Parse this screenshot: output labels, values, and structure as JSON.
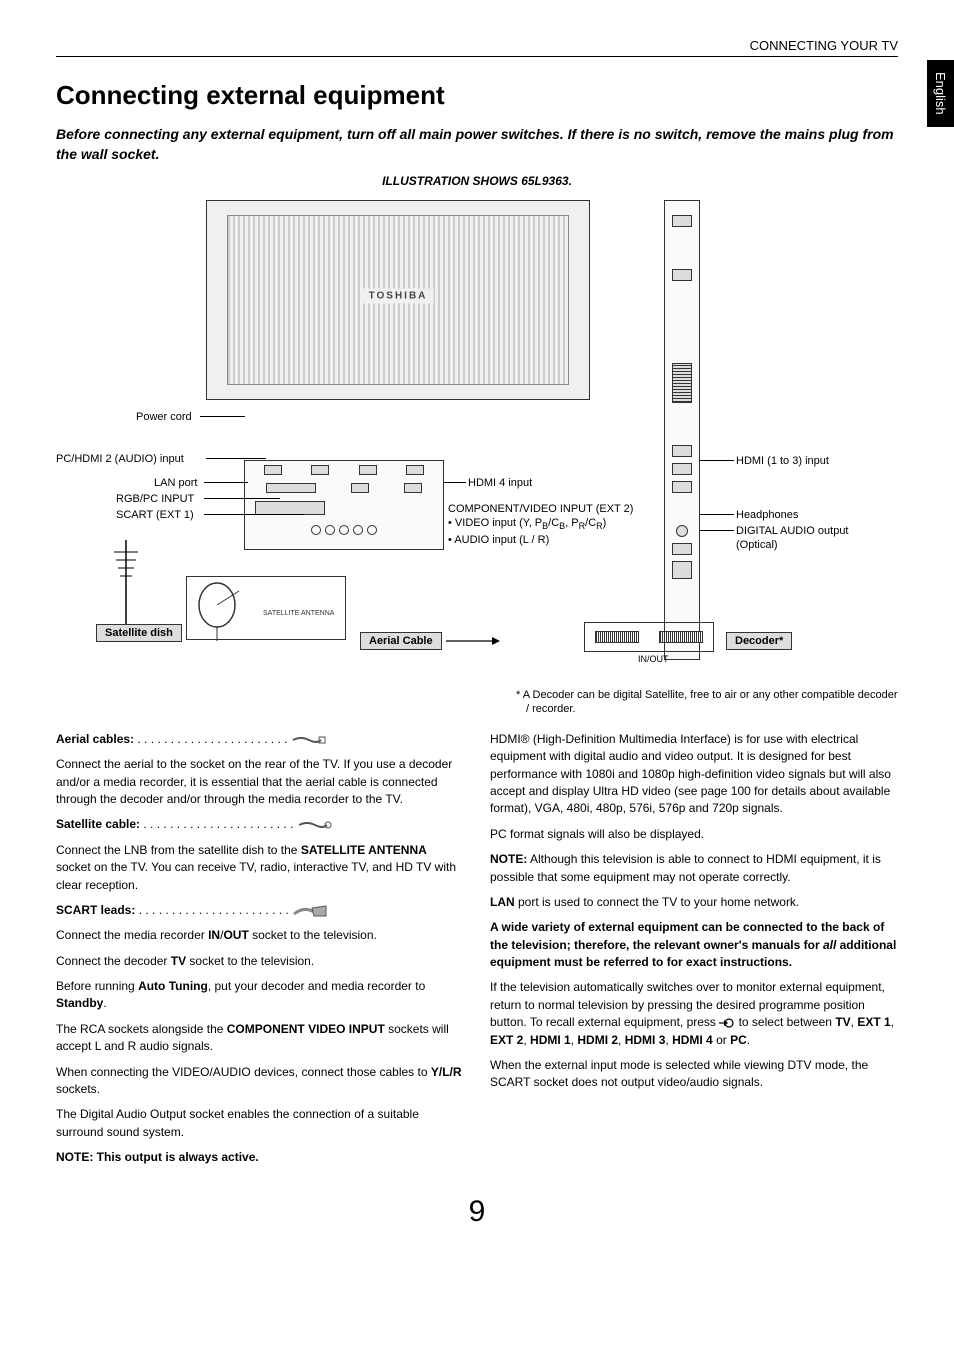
{
  "header": {
    "section": "CONNECTING YOUR TV"
  },
  "lang_tab": "English",
  "title": "Connecting external equipment",
  "subtitle": "Before connecting any external equipment, turn off all main power switches. If there is no switch, remove the mains plug from the wall socket.",
  "illustration_title": "ILLUSTRATION SHOWS 65L9363.",
  "diagram": {
    "tv_logo": "TOSHIBA",
    "labels": {
      "power_cord": "Power cord",
      "pc_hdmi2_audio": "PC/HDMI 2 (AUDIO) input",
      "lan_port": "LAN port",
      "rgb_pc": "RGB/PC INPUT",
      "scart": "SCART (EXT 1)",
      "hdmi4": "HDMI 4 input",
      "component_title": "COMPONENT/VIDEO INPUT (EXT 2)",
      "component_bullet1_a": "VIDEO input (Y, P",
      "component_bullet1_b": "B",
      "component_bullet1_c": "/C",
      "component_bullet1_d": "B",
      "component_bullet1_e": ", P",
      "component_bullet1_f": "R",
      "component_bullet1_g": "/C",
      "component_bullet1_h": "R",
      "component_bullet1_i": ")",
      "component_bullet2": "AUDIO input (L / R)",
      "hdmi13": "HDMI (1 to 3) input",
      "headphones": "Headphones",
      "digital_audio": "DIGITAL AUDIO output (Optical)"
    },
    "callouts": {
      "satellite_dish": "Satellite dish",
      "aerial_cable": "Aerial Cable",
      "decoder": "Decoder*",
      "in_out": "IN/OUT"
    }
  },
  "footnote": "*  A Decoder can be digital Satellite, free to air or any other compatible decoder / recorder.",
  "left_col": {
    "aerial_head": "Aerial cables:",
    "aerial_body": "Connect the aerial to the socket on the rear of the TV. If you use a decoder and/or a media recorder, it is essential that the aerial cable is connected through the decoder and/or through the media recorder to the TV.",
    "satellite_head": "Satellite cable:",
    "satellite_body_a": "Connect the LNB from the satellite dish to the ",
    "satellite_body_b": "SATELLITE ANTENNA",
    "satellite_body_c": " socket on the TV. You can receive TV, radio, interactive TV, and HD TV with clear reception.",
    "scart_head": "SCART leads:",
    "scart_body1_a": "Connect the media recorder ",
    "scart_body1_b": "IN",
    "scart_body1_c": "/",
    "scart_body1_d": "OUT",
    "scart_body1_e": " socket to the television.",
    "scart_body2_a": "Connect the decoder ",
    "scart_body2_b": "TV",
    "scart_body2_c": " socket to the television.",
    "scart_body3_a": "Before running ",
    "scart_body3_b": "Auto Tuning",
    "scart_body3_c": ", put your decoder and media recorder to ",
    "scart_body3_d": "Standby",
    "scart_body3_e": ".",
    "rca_a": "The RCA sockets alongside the ",
    "rca_b": "COMPONENT VIDEO INPUT",
    "rca_c": " sockets will accept L and R audio signals.",
    "video_audio_a": "When connecting the VIDEO/AUDIO devices, connect those cables to ",
    "video_audio_b": "Y/L/R",
    "video_audio_c": " sockets.",
    "digital_audio": "The Digital Audio Output socket enables the connection of a suitable surround sound system.",
    "note": "NOTE: This output is always active."
  },
  "right_col": {
    "hdmi": "HDMI® (High-Definition Multimedia Interface) is for use with electrical equipment with digital audio and video output. It is designed for best performance with 1080i and 1080p high-definition video signals but will also accept and display Ultra HD video (see page 100 for details about available format), VGA, 480i, 480p, 576i, 576p and 720p signals.",
    "pc_format": "PC format signals will also be displayed.",
    "note_hdmi_a": "NOTE:",
    "note_hdmi_b": " Although this television is able to connect to HDMI equipment, it is possible that some equipment may not operate correctly.",
    "lan_a": "LAN",
    "lan_b": " port is used to connect the TV to your home network.",
    "wide_variety_a": "A wide variety of external equipment can be connected to the back of the television; therefore, the relevant owner's manuals for ",
    "wide_variety_b": "all",
    "wide_variety_c": " additional equipment must be referred to for exact instructions.",
    "auto_switch_a": "If the television automatically switches over to monitor external equipment, return to normal television by pressing the desired programme position button. To recall external equipment, press ",
    "auto_switch_b": " to select between ",
    "auto_switch_c": "TV",
    "auto_switch_d": ", ",
    "auto_switch_e": "EXT 1",
    "auto_switch_f": "EXT 2",
    "auto_switch_g": "HDMI 1",
    "auto_switch_h": "HDMI 2",
    "auto_switch_i": "HDMI 3",
    "auto_switch_j": "HDMI 4",
    "auto_switch_k": " or ",
    "auto_switch_l": "PC",
    "auto_switch_m": ".",
    "dtv": "When the external input mode is selected while viewing DTV mode, the SCART socket does not output video/audio signals."
  },
  "page_num": "9"
}
